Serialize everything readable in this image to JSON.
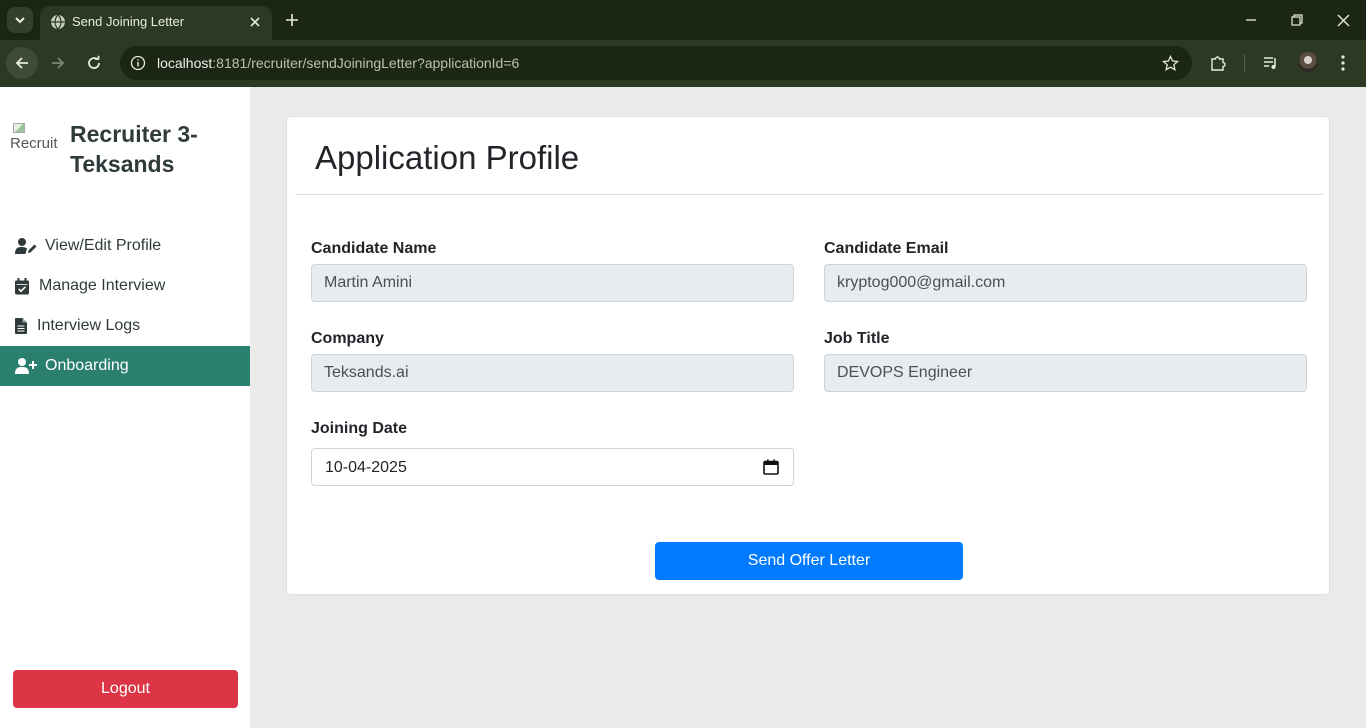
{
  "browser": {
    "tab_title": "Send Joining Letter",
    "url_host": "localhost",
    "url_rest": ":8181/recruiter/sendJoiningLetter?applicationId=6"
  },
  "sidebar": {
    "logo_alt": "Recruit",
    "brand": "Recruiter 3-Teksands",
    "items": [
      {
        "label": "View/Edit Profile",
        "icon": "user-edit-icon",
        "active": false
      },
      {
        "label": "Manage Interview",
        "icon": "calendar-check-icon",
        "active": false
      },
      {
        "label": "Interview Logs",
        "icon": "file-icon",
        "active": false
      },
      {
        "label": "Onboarding",
        "icon": "user-plus-icon",
        "active": true
      }
    ],
    "logout_label": "Logout"
  },
  "page": {
    "title": "Application Profile",
    "fields": {
      "candidate_name": {
        "label": "Candidate Name",
        "value": "Martin Amini"
      },
      "candidate_email": {
        "label": "Candidate Email",
        "value": "kryptog000@gmail.com"
      },
      "company": {
        "label": "Company",
        "value": "Teksands.ai"
      },
      "job_title": {
        "label": "Job Title",
        "value": "DEVOPS Engineer"
      },
      "joining_date": {
        "label": "Joining Date",
        "value": "10-04-2025"
      }
    },
    "submit_label": "Send Offer Letter"
  },
  "colors": {
    "sidebar_active": "#2b7f6f",
    "logout": "#dc3545",
    "primary": "#007bff",
    "chrome_dark": "#1b2614",
    "chrome_mid": "#2c3a24"
  }
}
